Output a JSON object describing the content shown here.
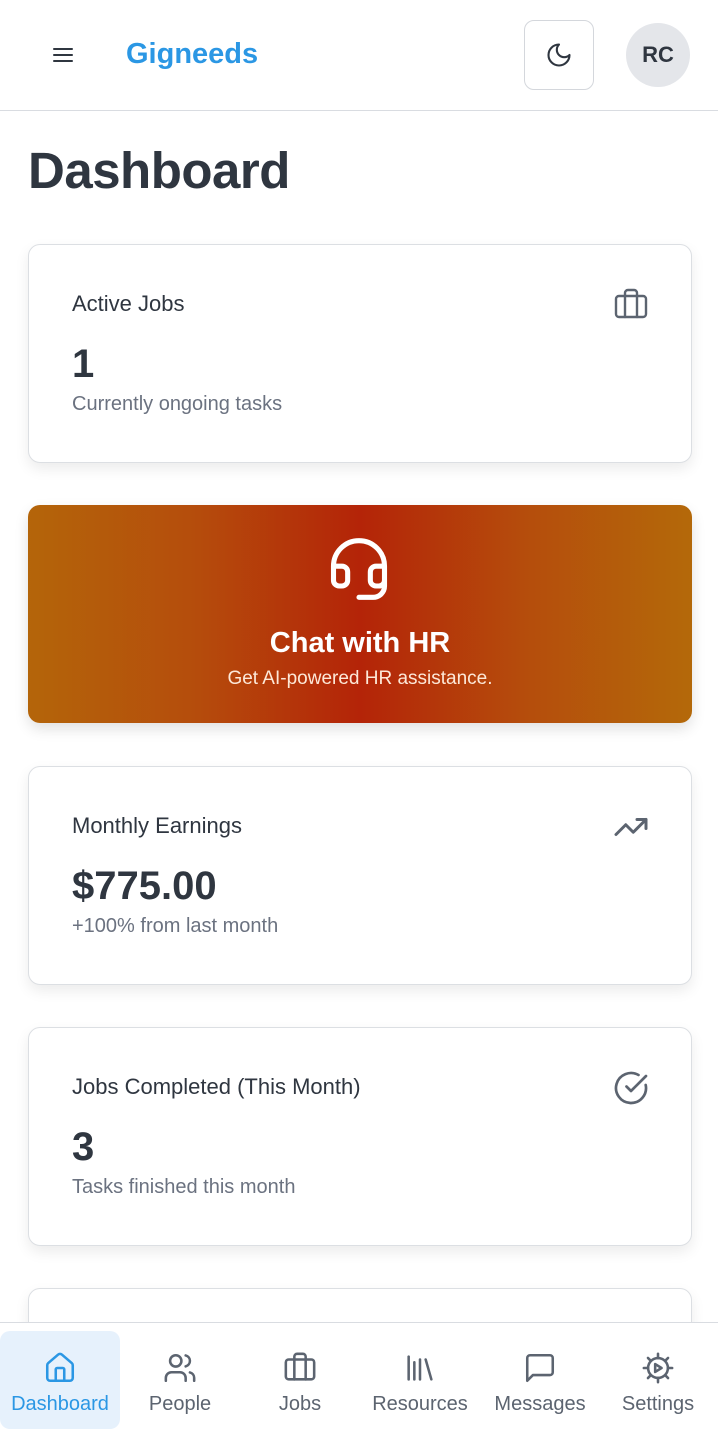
{
  "header": {
    "brand": "Gigneeds",
    "avatar_initials": "RC"
  },
  "page": {
    "title": "Dashboard"
  },
  "cards": {
    "active_jobs": {
      "title": "Active Jobs",
      "value": "1",
      "subtitle": "Currently ongoing tasks",
      "icon": "briefcase-icon"
    },
    "hr_chat": {
      "title": "Chat with HR",
      "subtitle": "Get AI-powered HR assistance.",
      "icon": "headset-icon"
    },
    "monthly_earnings": {
      "title": "Monthly Earnings",
      "value": "$775.00",
      "subtitle": "+100% from last month",
      "icon": "trending-up-icon"
    },
    "jobs_completed": {
      "title": "Jobs Completed (This Month)",
      "value": "3",
      "subtitle": "Tasks finished this month",
      "icon": "check-circle-icon"
    }
  },
  "bottom_nav": {
    "items": [
      {
        "label": "Dashboard",
        "icon": "home-icon",
        "active": true
      },
      {
        "label": "People",
        "icon": "users-icon",
        "active": false
      },
      {
        "label": "Jobs",
        "icon": "briefcase-icon",
        "active": false
      },
      {
        "label": "Resources",
        "icon": "library-icon",
        "active": false
      },
      {
        "label": "Messages",
        "icon": "message-icon",
        "active": false
      },
      {
        "label": "Settings",
        "icon": "gear-icon",
        "active": false
      }
    ]
  },
  "colors": {
    "brand": "#2b97e4",
    "text": "#2f3640",
    "muted": "#6b7280",
    "hr_gradient_center": "#b42408",
    "hr_gradient_edge": "#b4650a",
    "nav_active_bg": "#e6f1fc"
  }
}
